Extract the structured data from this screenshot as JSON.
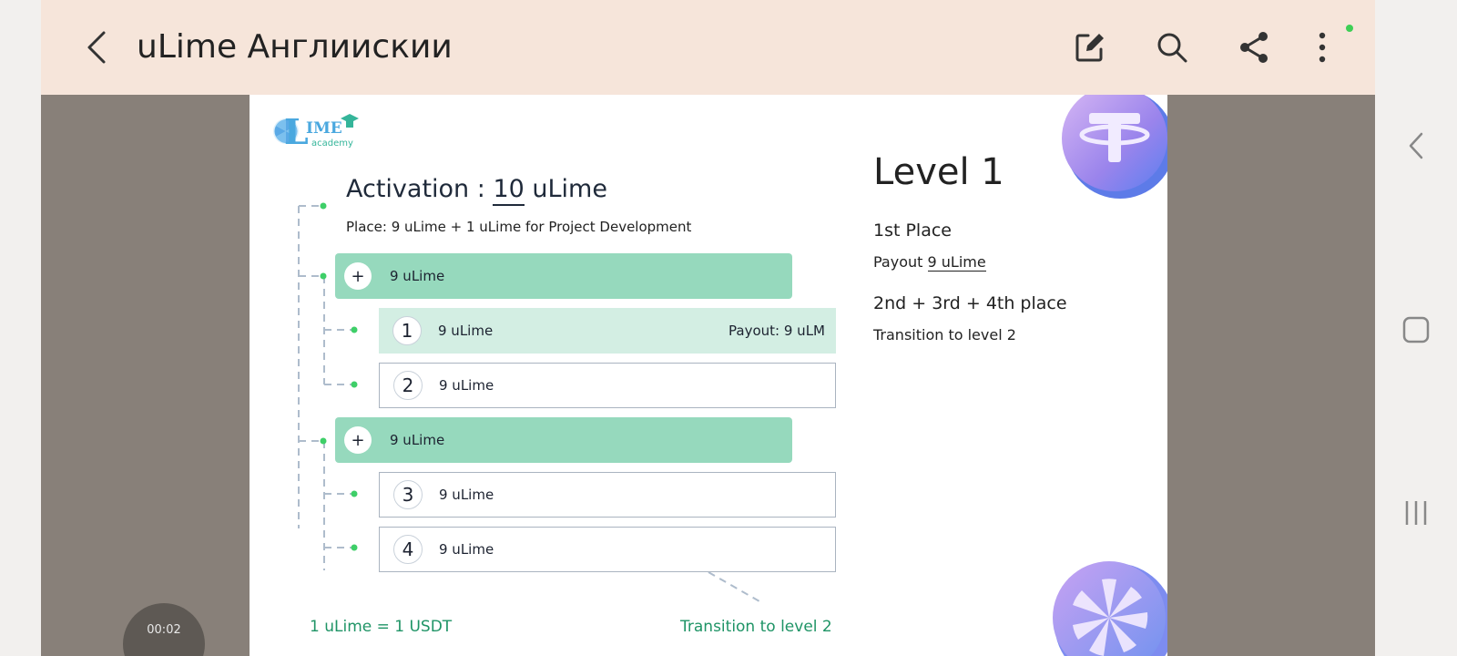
{
  "appbar": {
    "title": "uLime Англиискии",
    "tools": [
      "edit-icon",
      "search-icon",
      "share-icon",
      "more-vert-icon"
    ]
  },
  "slide": {
    "logo": {
      "big": "IME",
      "small": "academy"
    },
    "activation_prefix": "Activation : ",
    "activation_value": "10",
    "activation_suffix": " uLime",
    "place_note": "Place: 9 uLime + 1 uLime for Project Development",
    "rows": [
      {
        "marker": "+",
        "label": "9 uLime"
      },
      {
        "marker": "1",
        "label": "9 uLime",
        "payout": "Payout: 9 uLM"
      },
      {
        "marker": "2",
        "label": "9 uLime"
      },
      {
        "marker": "+",
        "label": "9 uLime"
      },
      {
        "marker": "3",
        "label": "9 uLime"
      },
      {
        "marker": "4",
        "label": "9 uLime"
      }
    ],
    "right": {
      "level_title": "Level 1",
      "first_place": "1st Place",
      "payout_prefix": "Payout ",
      "payout_value": "9 uLime",
      "other_places": "2nd + 3rd + 4th place",
      "transition": "Transition to level 2"
    },
    "footer_left": "1 uLime = 1 USDT",
    "footer_right": "Transition to level 2"
  },
  "player": {
    "timer": "00:02"
  },
  "colors": {
    "appbar": "#f6e5da",
    "group_row": "#96d9bd",
    "active_row": "#d3eee3",
    "accent_green": "#1f9466",
    "backdrop": "#888079"
  }
}
